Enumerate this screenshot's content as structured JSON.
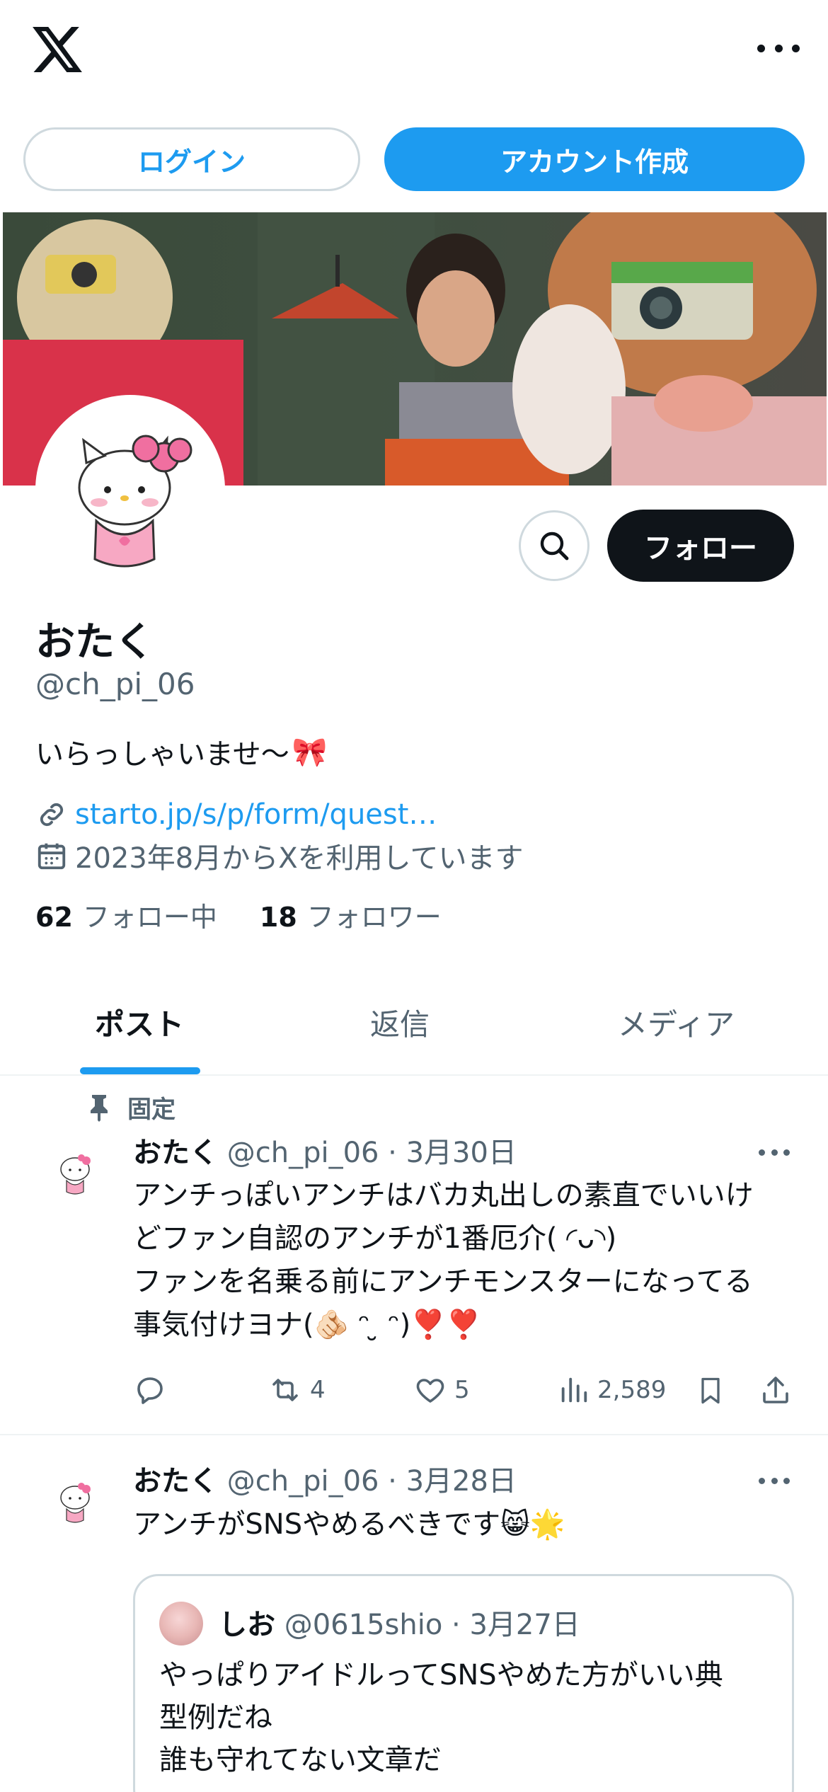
{
  "header": {
    "logo_icon": "x-logo-icon",
    "more_icon": "more-horizontal-icon"
  },
  "auth": {
    "login_label": "ログイン",
    "signup_label": "アカウント作成"
  },
  "profile": {
    "name": "おたく",
    "handle": "@ch_pi_06",
    "bio": "いらっしゃいませ〜",
    "bio_emoji": "🎀",
    "link": "starto.jp/s/p/form/quest…",
    "joined": "2023年8月からXを利用しています",
    "following_count": "62",
    "following_label": "フォロー中",
    "followers_count": "18",
    "followers_label": "フォロワー",
    "follow_label": "フォロー"
  },
  "tabs": [
    {
      "label": "ポスト"
    },
    {
      "label": "返信"
    },
    {
      "label": "メディア"
    }
  ],
  "tweets": [
    {
      "pinned_label": "固定",
      "author": "おたく",
      "meta": "@ch_pi_06 · 3月30日",
      "lines": [
        "アンチっぽいアンチはバカ丸出しの素直でいいけ",
        "どファン自認のアンチが1番厄介( ◜ᴗ◝)",
        "ファンを名乗る前にアンチモンスターになってる",
        "事気付けヨナ(🫵🏻 ᵔ ̮ ᵔ)❣️❣️"
      ],
      "retweets": "4",
      "likes": "5",
      "views": "2,589"
    },
    {
      "author": "おたく",
      "meta": "@ch_pi_06 · 3月28日",
      "lines": [
        "アンチがSNSやめるべきです😸🌟"
      ],
      "quote": {
        "author": "しお",
        "meta": "@0615shio · 3月27日",
        "lines": [
          "やっぱりアイドルってSNSやめた方がいい典",
          "型例だね",
          "誰も守れてない文章だ"
        ]
      }
    }
  ],
  "colors": {
    "accent": "#1d9bf0",
    "text": "#0f1419",
    "muted": "#536471",
    "border": "#cfd9de"
  }
}
